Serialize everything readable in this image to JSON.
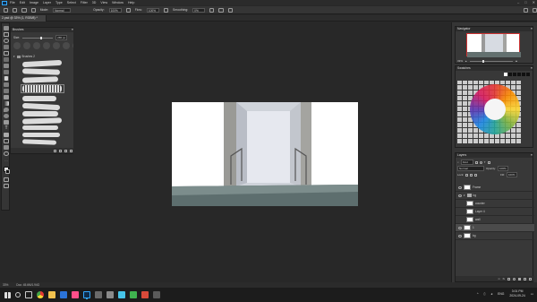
{
  "menu": [
    "File",
    "Edit",
    "Image",
    "Layer",
    "Type",
    "Select",
    "Filter",
    "3D",
    "View",
    "Window",
    "Help"
  ],
  "options_bar": {
    "mode_label": "Mode:",
    "mode_value": "Normal",
    "opacity_label": "Opacity:",
    "opacity_value": "100%",
    "flow_label": "Flow:",
    "flow_value": "100%",
    "smoothing_label": "Smoothing:",
    "smoothing_value": "0%"
  },
  "document_tab": "2.psd @ 33% (1, RGB/8) *",
  "brushes_panel": {
    "title": "Brushes",
    "size_label": "Size:",
    "size_value": "265 px",
    "group_label": "Brushes 2"
  },
  "navigator": {
    "title": "Navigator",
    "zoom": "33%"
  },
  "swatches": {
    "title": "Swatches"
  },
  "layers_panel": {
    "title": "Layers",
    "filter_label": "Kind",
    "blend_mode": "Normal",
    "opacity_label": "Opacity:",
    "opacity_value": "100%",
    "fill_label": "Fill:",
    "fill_value": "100%",
    "lock_label": "Lock:",
    "layers": [
      {
        "name": "Frame",
        "selected": false
      },
      {
        "name": "bg",
        "selected": false
      },
      {
        "name": "counter",
        "selected": false
      },
      {
        "name": "Layer 4",
        "selected": false
      },
      {
        "name": "wall",
        "selected": false
      },
      {
        "name": "1",
        "selected": true
      },
      {
        "name": "bg",
        "selected": false
      }
    ]
  },
  "status_bar": {
    "zoom": "33%",
    "doc_info": "Doc: 45.6M/1.94G"
  },
  "taskbar": {
    "language": "ENG",
    "time": "3:01 PM",
    "date": "2024-09-24"
  },
  "colors": {
    "accent": "#31a8ff",
    "panel": "#383838",
    "workspace": "#282828"
  }
}
